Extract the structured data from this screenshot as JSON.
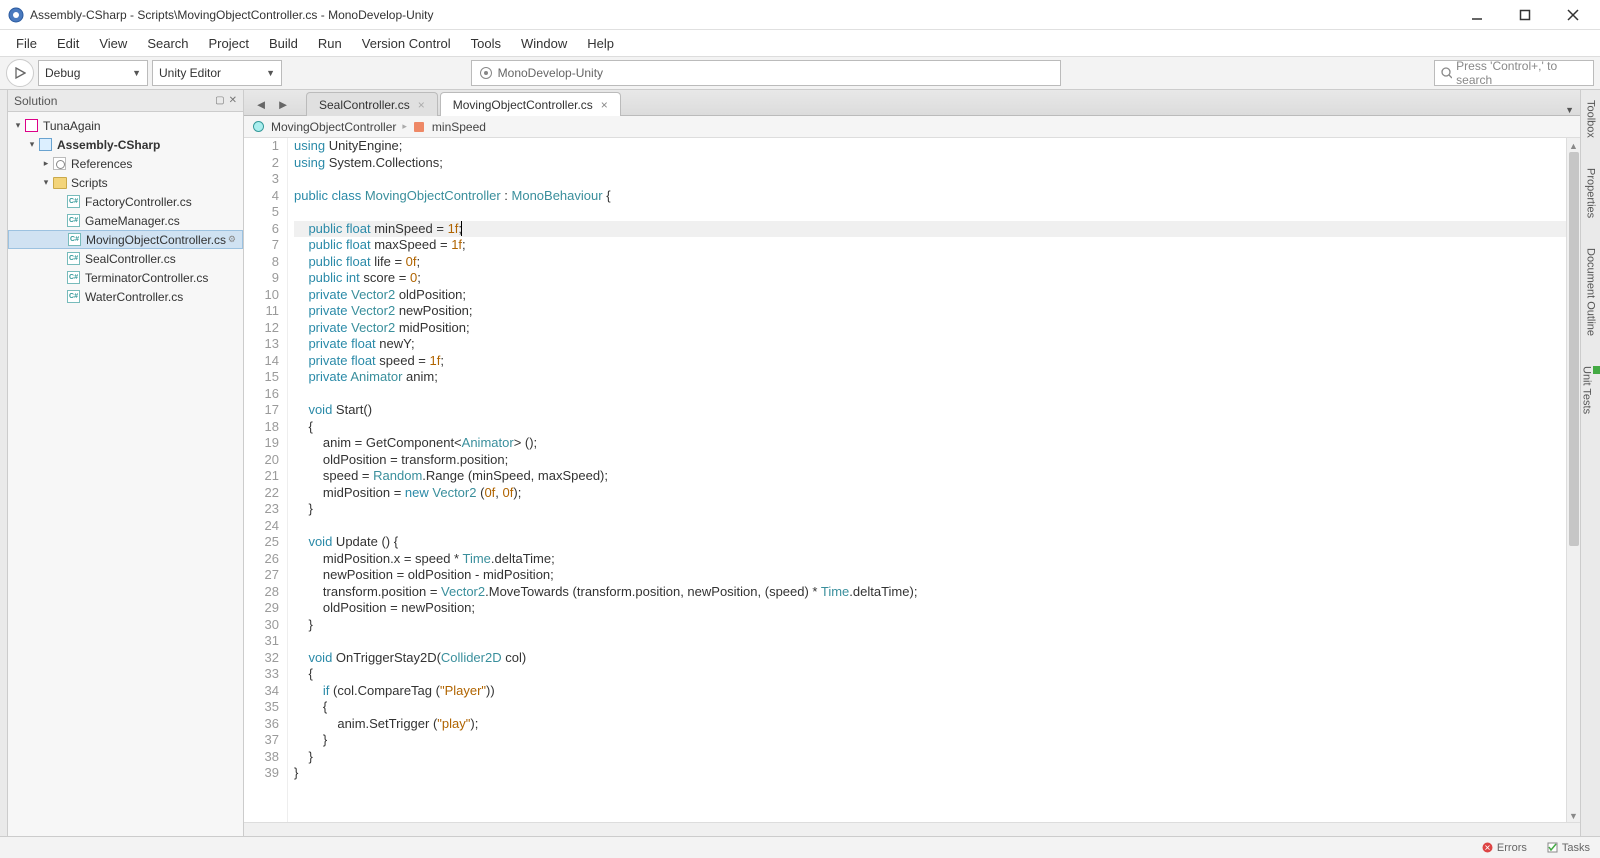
{
  "title": "Assembly-CSharp - Scripts\\MovingObjectController.cs - MonoDevelop-Unity",
  "menus": [
    "File",
    "Edit",
    "View",
    "Search",
    "Project",
    "Build",
    "Run",
    "Version Control",
    "Tools",
    "Window",
    "Help"
  ],
  "toolbar": {
    "config": "Debug",
    "target": "Unity Editor",
    "center_search_text": "MonoDevelop-Unity",
    "right_search_placeholder": "Press 'Control+,' to search"
  },
  "solution": {
    "panel_title": "Solution",
    "root": "TunaAgain",
    "project": "Assembly-CSharp",
    "references": "References",
    "scripts_folder": "Scripts",
    "files": [
      "FactoryController.cs",
      "GameManager.cs",
      "MovingObjectController.cs",
      "SealController.cs",
      "TerminatorController.cs",
      "WaterController.cs"
    ],
    "selected_file": "MovingObjectController.cs"
  },
  "tabs": {
    "inactive": "SealController.cs",
    "active": "MovingObjectController.cs"
  },
  "breadcrumb": {
    "class": "MovingObjectController",
    "member": "minSpeed"
  },
  "code_lines": [
    [
      [
        "kw",
        "using"
      ],
      [
        "",
        " UnityEngine;"
      ]
    ],
    [
      [
        "kw",
        "using"
      ],
      [
        "",
        " System.Collections;"
      ]
    ],
    [
      [
        "",
        ""
      ]
    ],
    [
      [
        "kw",
        "public class"
      ],
      [
        "",
        " "
      ],
      [
        "type",
        "MovingObjectController"
      ],
      [
        "",
        " : "
      ],
      [
        "type",
        "MonoBehaviour"
      ],
      [
        "",
        " {"
      ]
    ],
    [
      [
        "",
        ""
      ]
    ],
    [
      [
        "",
        "    "
      ],
      [
        "kw",
        "public float"
      ],
      [
        "",
        " minSpeed = "
      ],
      [
        "num",
        "1f"
      ],
      [
        "",
        ";"
      ]
    ],
    [
      [
        "",
        "    "
      ],
      [
        "kw",
        "public float"
      ],
      [
        "",
        " maxSpeed = "
      ],
      [
        "num",
        "1f"
      ],
      [
        "",
        ";"
      ]
    ],
    [
      [
        "",
        "    "
      ],
      [
        "kw",
        "public float"
      ],
      [
        "",
        " life = "
      ],
      [
        "num",
        "0f"
      ],
      [
        "",
        ";"
      ]
    ],
    [
      [
        "",
        "    "
      ],
      [
        "kw",
        "public int"
      ],
      [
        "",
        " score = "
      ],
      [
        "num",
        "0"
      ],
      [
        "",
        ";"
      ]
    ],
    [
      [
        "",
        "    "
      ],
      [
        "kw",
        "private"
      ],
      [
        "",
        " "
      ],
      [
        "type",
        "Vector2"
      ],
      [
        "",
        " oldPosition;"
      ]
    ],
    [
      [
        "",
        "    "
      ],
      [
        "kw",
        "private"
      ],
      [
        "",
        " "
      ],
      [
        "type",
        "Vector2"
      ],
      [
        "",
        " newPosition;"
      ]
    ],
    [
      [
        "",
        "    "
      ],
      [
        "kw",
        "private"
      ],
      [
        "",
        " "
      ],
      [
        "type",
        "Vector2"
      ],
      [
        "",
        " midPosition;"
      ]
    ],
    [
      [
        "",
        "    "
      ],
      [
        "kw",
        "private float"
      ],
      [
        "",
        " newY;"
      ]
    ],
    [
      [
        "",
        "    "
      ],
      [
        "kw",
        "private float"
      ],
      [
        "",
        " speed = "
      ],
      [
        "num",
        "1f"
      ],
      [
        "",
        ";"
      ]
    ],
    [
      [
        "",
        "    "
      ],
      [
        "kw",
        "private"
      ],
      [
        "",
        " "
      ],
      [
        "type",
        "Animator"
      ],
      [
        "",
        " anim;"
      ]
    ],
    [
      [
        "",
        ""
      ]
    ],
    [
      [
        "",
        "    "
      ],
      [
        "kw",
        "void"
      ],
      [
        "",
        " Start()"
      ]
    ],
    [
      [
        "",
        "    {"
      ]
    ],
    [
      [
        "",
        "        anim = GetComponent<"
      ],
      [
        "type",
        "Animator"
      ],
      [
        "",
        "> ();"
      ]
    ],
    [
      [
        "",
        "        oldPosition = transform.position;"
      ]
    ],
    [
      [
        "",
        "        speed = "
      ],
      [
        "type",
        "Random"
      ],
      [
        "",
        ".Range (minSpeed, maxSpeed);"
      ]
    ],
    [
      [
        "",
        "        midPosition = "
      ],
      [
        "kw",
        "new"
      ],
      [
        "",
        " "
      ],
      [
        "type",
        "Vector2"
      ],
      [
        "",
        " ("
      ],
      [
        "num",
        "0f"
      ],
      [
        "",
        ", "
      ],
      [
        "num",
        "0f"
      ],
      [
        "",
        ");"
      ]
    ],
    [
      [
        "",
        "    }"
      ]
    ],
    [
      [
        "",
        ""
      ]
    ],
    [
      [
        "",
        "    "
      ],
      [
        "kw",
        "void"
      ],
      [
        "",
        " Update () {"
      ]
    ],
    [
      [
        "",
        "        midPosition.x = speed * "
      ],
      [
        "type",
        "Time"
      ],
      [
        "",
        ".deltaTime;"
      ]
    ],
    [
      [
        "",
        "        newPosition = oldPosition - midPosition;"
      ]
    ],
    [
      [
        "",
        "        transform.position = "
      ],
      [
        "type",
        "Vector2"
      ],
      [
        "",
        ".MoveTowards (transform.position, newPosition, (speed) * "
      ],
      [
        "type",
        "Time"
      ],
      [
        "",
        ".deltaTime);"
      ]
    ],
    [
      [
        "",
        "        oldPosition = newPosition;"
      ]
    ],
    [
      [
        "",
        "    }"
      ]
    ],
    [
      [
        "",
        ""
      ]
    ],
    [
      [
        "",
        "    "
      ],
      [
        "kw",
        "void"
      ],
      [
        "",
        " OnTriggerStay2D("
      ],
      [
        "type",
        "Collider2D"
      ],
      [
        "",
        " col)"
      ]
    ],
    [
      [
        "",
        "    {"
      ]
    ],
    [
      [
        "",
        "        "
      ],
      [
        "kw",
        "if"
      ],
      [
        "",
        " (col.CompareTag ("
      ],
      [
        "str",
        "\"Player\""
      ],
      [
        "",
        "))"
      ]
    ],
    [
      [
        "",
        "        {"
      ]
    ],
    [
      [
        "",
        "            anim.SetTrigger ("
      ],
      [
        "str",
        "\"play\""
      ],
      [
        "",
        ");"
      ]
    ],
    [
      [
        "",
        "        }"
      ]
    ],
    [
      [
        "",
        "    }"
      ]
    ],
    [
      [
        "",
        "}"
      ]
    ]
  ],
  "current_line": 6,
  "right_panels": [
    "Toolbox",
    "Properties",
    "Document Outline",
    "Unit Tests"
  ],
  "status": {
    "errors": "Errors",
    "tasks": "Tasks"
  }
}
